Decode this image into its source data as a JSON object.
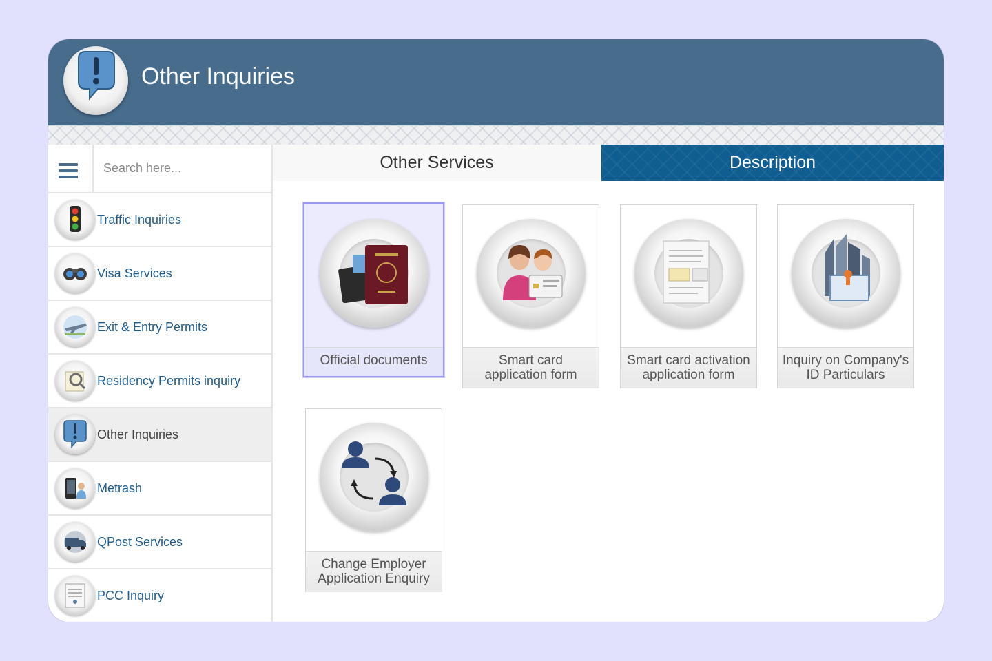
{
  "header": {
    "title": "Other Inquiries",
    "icon": "exclamation-speech-bubble-icon"
  },
  "search": {
    "placeholder": "Search here..."
  },
  "sidebar": {
    "items": [
      {
        "label": "Traffic Inquiries",
        "icon": "traffic-light-icon"
      },
      {
        "label": "Visa Services",
        "icon": "binoculars-icon"
      },
      {
        "label": "Exit & Entry Permits",
        "icon": "airplane-icon"
      },
      {
        "label": "Residency Permits inquiry",
        "icon": "magnifier-document-icon"
      },
      {
        "label": "Other Inquiries",
        "icon": "exclamation-speech-bubble-icon",
        "active": true
      },
      {
        "label": "Metrash",
        "icon": "metrash-phone-icon"
      },
      {
        "label": "QPost Services",
        "icon": "delivery-truck-icon"
      },
      {
        "label": "PCC Inquiry",
        "icon": "certificate-icon"
      }
    ]
  },
  "tabs": {
    "other_services": "Other Services",
    "description": "Description"
  },
  "cards": [
    {
      "line1": "Official documents",
      "line2": "",
      "icon": "passport-icon",
      "selected": true
    },
    {
      "line1": "Smart card",
      "line2": "application form",
      "icon": "smart-card-people-icon"
    },
    {
      "line1": "Smart card activation",
      "line2": "application form",
      "icon": "document-form-icon"
    },
    {
      "line1": "Inquiry on Company's",
      "line2": "ID Particulars",
      "icon": "company-building-certificate-icon"
    },
    {
      "line1": "Change Employer",
      "line2": "Application Enquiry",
      "icon": "change-employer-arrows-icon"
    }
  ],
  "colors": {
    "header": "#486c8c",
    "accent_tab": "#0f5d91",
    "link": "#1f5d8e",
    "background": "#e1e0fd"
  }
}
